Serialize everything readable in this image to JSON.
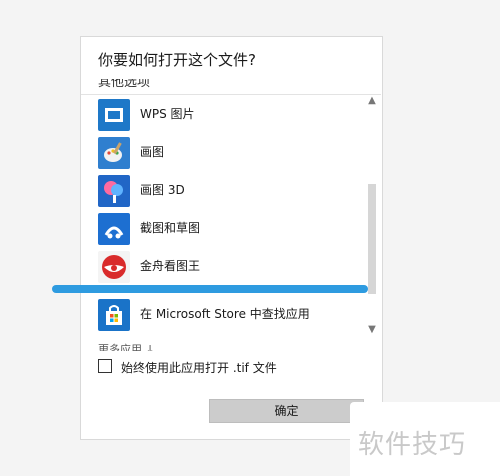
{
  "dialog": {
    "title": "你要如何打开这个文件?",
    "section_label": "其他选项",
    "more_apps_label": "更多应用 ↓",
    "checkbox": {
      "label": "始终使用此应用打开 .tif 文件",
      "checked": false
    },
    "ok_button": "确定"
  },
  "apps": [
    {
      "label": "WPS 图片",
      "icon": "wps-pictures-icon",
      "color": "#1e78c8"
    },
    {
      "label": "画图",
      "icon": "paint-icon",
      "color": "#2f7fcf"
    },
    {
      "label": "画图 3D",
      "icon": "paint-3d-icon",
      "color": "#2166c6"
    },
    {
      "label": "截图和草图",
      "icon": "snip-sketch-icon",
      "color": "#1d6fd1"
    },
    {
      "label": "金舟看图王",
      "icon": "jinzhou-viewer-icon",
      "color": "#d92b2b"
    },
    {
      "label": "在 Microsoft Store 中查找应用",
      "icon": "microsoft-store-icon",
      "color": "#1a73c8"
    }
  ],
  "watermark": "软件技巧",
  "colors": {
    "accent": "#2e9be0",
    "button_bg": "#cccccc"
  }
}
